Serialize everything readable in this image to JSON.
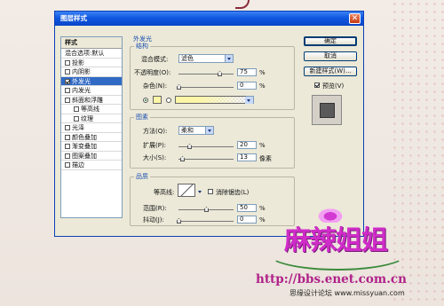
{
  "dialog": {
    "title": "图层样式",
    "close_glyph": "✕"
  },
  "style_list": {
    "header": "样式",
    "items": [
      {
        "label": "混合选项:默认",
        "checkbox": false,
        "checked": false
      },
      {
        "label": "投影",
        "checkbox": true,
        "checked": false
      },
      {
        "label": "内阴影",
        "checkbox": true,
        "checked": false
      },
      {
        "label": "外发光",
        "checkbox": true,
        "checked": true,
        "selected": true
      },
      {
        "label": "内发光",
        "checkbox": true,
        "checked": false
      },
      {
        "label": "斜面和浮雕",
        "checkbox": true,
        "checked": false
      },
      {
        "label": "等高线",
        "checkbox": true,
        "checked": false,
        "indent": true
      },
      {
        "label": "纹理",
        "checkbox": true,
        "checked": false,
        "indent": true
      },
      {
        "label": "光泽",
        "checkbox": true,
        "checked": false
      },
      {
        "label": "颜色叠加",
        "checkbox": true,
        "checked": false
      },
      {
        "label": "渐变叠加",
        "checkbox": true,
        "checked": false
      },
      {
        "label": "图案叠加",
        "checkbox": true,
        "checked": false
      },
      {
        "label": "描边",
        "checkbox": true,
        "checked": false
      }
    ]
  },
  "outer_glow": {
    "title": "外发光",
    "structure": {
      "title": "结构",
      "blend_mode_label": "混合模式:",
      "blend_mode_value": "滤色",
      "opacity_label": "不透明度(O):",
      "opacity_value": "75",
      "noise_label": "杂色(N):",
      "noise_value": "0",
      "percent": "%",
      "glow_color": "#fdf6a6"
    },
    "elements": {
      "title": "图素",
      "technique_label": "方法(Q):",
      "technique_value": "柔和",
      "spread_label": "扩展(P):",
      "spread_value": "20",
      "size_label": "大小(S):",
      "size_value": "13",
      "px_unit": "像素",
      "percent": "%"
    },
    "quality": {
      "title": "品质",
      "contour_label": "等高线:",
      "anti_alias_label": "消除锯齿(L)",
      "range_label": "范围(R):",
      "range_value": "50",
      "jitter_label": "抖动(J):",
      "jitter_value": "0",
      "percent": "%"
    }
  },
  "buttons": {
    "ok": "确定",
    "cancel": "取消",
    "new_style": "新建样式(W)...",
    "preview_label": "预览(V)",
    "preview_checked": true
  },
  "watermark": {
    "logo": "麻辣姐姐",
    "url": "http://bbs.enet.com.cn",
    "site": "思缘设计论坛 www.missyuan.com"
  }
}
